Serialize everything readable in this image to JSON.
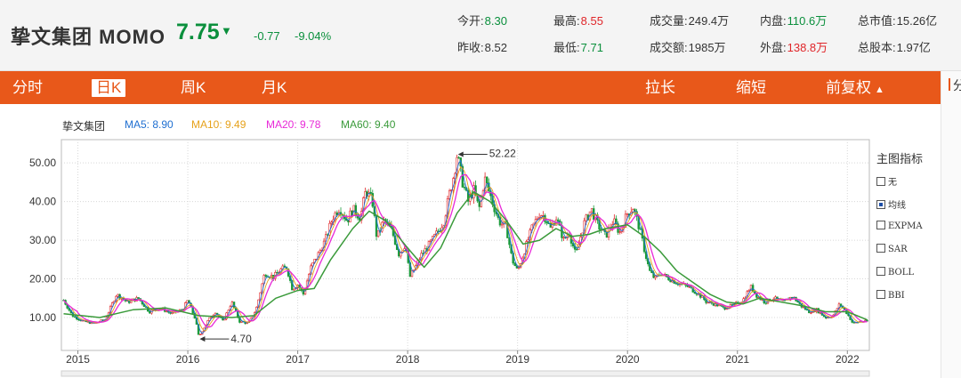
{
  "stock": {
    "name": "挚文集团",
    "ticker": "MOMO",
    "price": "7.75",
    "arrow": "▼",
    "change": "-0.77",
    "change_pct": "-9.04%"
  },
  "quote_stats": {
    "open": {
      "label": "今开:",
      "value": "8.30"
    },
    "prev_close": {
      "label": "昨收:",
      "value": "8.52"
    },
    "high": {
      "label": "最高:",
      "value": "8.55"
    },
    "low": {
      "label": "最低:",
      "value": "7.71"
    },
    "volume": {
      "label": "成交量:",
      "value": "249.4万"
    },
    "turnover": {
      "label": "成交额:",
      "value": "1985万"
    },
    "inner_vol": {
      "label": "内盘:",
      "value": "110.6万"
    },
    "outer_vol": {
      "label": "外盘:",
      "value": "138.8万"
    },
    "market_cap": {
      "label": "总市值:",
      "value": "15.26亿"
    },
    "total_shares": {
      "label": "总股本:",
      "value": "1.97亿"
    }
  },
  "toolbar": {
    "tabs": [
      "分时",
      "日K",
      "周K",
      "月K"
    ],
    "active_tab": "日K",
    "zoom_in": "拉长",
    "zoom_out": "缩短",
    "adjust": "前复权",
    "adjust_caret": "▲",
    "accent_color": "#e8581a"
  },
  "right_panel": {
    "label": "分"
  },
  "ma_legend": {
    "stock": "挚文集团",
    "ma5": "MA5: 8.90",
    "ma10": "MA10: 9.49",
    "ma20": "MA20: 9.78",
    "ma60": "MA60: 9.40",
    "colors": {
      "ma5": "#1f6fd1",
      "ma10": "#e6a11a",
      "ma20": "#e829d8",
      "ma60": "#3a9a3a"
    }
  },
  "indicator_panel": {
    "title": "主图指标",
    "options": [
      {
        "label": "无",
        "checked": false
      },
      {
        "label": "均线",
        "checked": true
      },
      {
        "label": "EXPMA",
        "checked": false
      },
      {
        "label": "SAR",
        "checked": false
      },
      {
        "label": "BOLL",
        "checked": false
      },
      {
        "label": "BBI",
        "checked": false
      }
    ]
  },
  "chart_data": {
    "type": "candlestick",
    "x_tick_labels": [
      "2015",
      "2016",
      "2017",
      "2018",
      "2019",
      "2020",
      "2021",
      "2022"
    ],
    "y_tick_labels": [
      "10.00",
      "20.00",
      "30.00",
      "40.00",
      "50.00"
    ],
    "ylim": [
      1.5,
      56
    ],
    "xlim": [
      2014.85,
      2022.2
    ],
    "grid": true,
    "annotations": [
      {
        "label": "52.22",
        "x": 2018.45,
        "y": 52.22
      },
      {
        "label": "4.70",
        "x": 2016.1,
        "y": 4.7
      }
    ],
    "price_path": [
      [
        2014.87,
        14.5
      ],
      [
        2014.95,
        10.5
      ],
      [
        2015.05,
        9.0
      ],
      [
        2015.15,
        8.5
      ],
      [
        2015.25,
        9.5
      ],
      [
        2015.35,
        16.0
      ],
      [
        2015.45,
        14.0
      ],
      [
        2015.55,
        15.0
      ],
      [
        2015.65,
        11.5
      ],
      [
        2015.75,
        12.5
      ],
      [
        2015.85,
        11.0
      ],
      [
        2015.95,
        12.0
      ],
      [
        2016.0,
        14.5
      ],
      [
        2016.07,
        9.5
      ],
      [
        2016.1,
        5.0
      ],
      [
        2016.18,
        9.0
      ],
      [
        2016.25,
        11.5
      ],
      [
        2016.32,
        9.0
      ],
      [
        2016.4,
        14.0
      ],
      [
        2016.47,
        9.0
      ],
      [
        2016.55,
        8.5
      ],
      [
        2016.62,
        12.0
      ],
      [
        2016.7,
        21.5
      ],
      [
        2016.78,
        20.5
      ],
      [
        2016.85,
        22.5
      ],
      [
        2016.9,
        23.0
      ],
      [
        2016.95,
        17.5
      ],
      [
        2017.0,
        18.5
      ],
      [
        2017.05,
        16.0
      ],
      [
        2017.12,
        23.0
      ],
      [
        2017.18,
        26.0
      ],
      [
        2017.25,
        30.0
      ],
      [
        2017.32,
        36.0
      ],
      [
        2017.38,
        38.5
      ],
      [
        2017.45,
        35.0
      ],
      [
        2017.5,
        38.0
      ],
      [
        2017.57,
        36.0
      ],
      [
        2017.62,
        43.0
      ],
      [
        2017.68,
        40.0
      ],
      [
        2017.72,
        30.5
      ],
      [
        2017.78,
        35.0
      ],
      [
        2017.85,
        33.0
      ],
      [
        2017.92,
        26.5
      ],
      [
        2017.98,
        29.0
      ],
      [
        2018.02,
        20.5
      ],
      [
        2018.07,
        23.0
      ],
      [
        2018.12,
        26.0
      ],
      [
        2018.2,
        29.0
      ],
      [
        2018.27,
        32.0
      ],
      [
        2018.33,
        35.0
      ],
      [
        2018.38,
        42.0
      ],
      [
        2018.42,
        47.0
      ],
      [
        2018.45,
        52.2
      ],
      [
        2018.5,
        45.0
      ],
      [
        2018.55,
        40.0
      ],
      [
        2018.6,
        43.0
      ],
      [
        2018.65,
        38.0
      ],
      [
        2018.7,
        46.0
      ],
      [
        2018.77,
        40.0
      ],
      [
        2018.83,
        35.0
      ],
      [
        2018.9,
        33.0
      ],
      [
        2018.95,
        25.0
      ],
      [
        2019.0,
        22.0
      ],
      [
        2019.07,
        28.0
      ],
      [
        2019.13,
        33.0
      ],
      [
        2019.2,
        37.0
      ],
      [
        2019.25,
        36.0
      ],
      [
        2019.3,
        33.0
      ],
      [
        2019.35,
        36.0
      ],
      [
        2019.42,
        30.0
      ],
      [
        2019.47,
        32.0
      ],
      [
        2019.53,
        26.0
      ],
      [
        2019.6,
        34.0
      ],
      [
        2019.67,
        38.0
      ],
      [
        2019.73,
        34.0
      ],
      [
        2019.8,
        31.0
      ],
      [
        2019.87,
        35.0
      ],
      [
        2019.93,
        32.0
      ],
      [
        2020.0,
        37.0
      ],
      [
        2020.05,
        38.5
      ],
      [
        2020.1,
        34.0
      ],
      [
        2020.15,
        28.0
      ],
      [
        2020.2,
        22.0
      ],
      [
        2020.25,
        20.0
      ],
      [
        2020.3,
        21.5
      ],
      [
        2020.35,
        20.5
      ],
      [
        2020.45,
        19.0
      ],
      [
        2020.55,
        18.0
      ],
      [
        2020.65,
        16.0
      ],
      [
        2020.72,
        14.0
      ],
      [
        2020.8,
        13.5
      ],
      [
        2020.87,
        12.5
      ],
      [
        2020.95,
        13.0
      ],
      [
        2021.05,
        14.5
      ],
      [
        2021.12,
        18.0
      ],
      [
        2021.18,
        15.5
      ],
      [
        2021.25,
        14.0
      ],
      [
        2021.33,
        15.0
      ],
      [
        2021.42,
        14.0
      ],
      [
        2021.5,
        15.5
      ],
      [
        2021.58,
        13.0
      ],
      [
        2021.65,
        11.5
      ],
      [
        2021.72,
        12.0
      ],
      [
        2021.8,
        10.0
      ],
      [
        2021.87,
        10.5
      ],
      [
        2021.93,
        13.5
      ],
      [
        2022.0,
        11.0
      ],
      [
        2022.05,
        8.5
      ],
      [
        2022.12,
        9.0
      ],
      [
        2022.18,
        9.0
      ]
    ],
    "ma60_path": [
      [
        2014.87,
        11.0
      ],
      [
        2015.2,
        10.0
      ],
      [
        2015.5,
        12.0
      ],
      [
        2015.8,
        12.5
      ],
      [
        2016.1,
        10.5
      ],
      [
        2016.4,
        10.0
      ],
      [
        2016.6,
        10.5
      ],
      [
        2016.8,
        15.0
      ],
      [
        2017.0,
        17.0
      ],
      [
        2017.15,
        17.5
      ],
      [
        2017.3,
        25.0
      ],
      [
        2017.5,
        33.0
      ],
      [
        2017.65,
        37.5
      ],
      [
        2017.8,
        35.0
      ],
      [
        2018.0,
        28.0
      ],
      [
        2018.15,
        23.0
      ],
      [
        2018.3,
        28.0
      ],
      [
        2018.45,
        37.0
      ],
      [
        2018.6,
        42.5
      ],
      [
        2018.75,
        40.0
      ],
      [
        2018.9,
        35.0
      ],
      [
        2019.05,
        29.0
      ],
      [
        2019.2,
        30.0
      ],
      [
        2019.35,
        33.0
      ],
      [
        2019.5,
        31.0
      ],
      [
        2019.65,
        31.5
      ],
      [
        2019.8,
        33.0
      ],
      [
        2020.0,
        34.0
      ],
      [
        2020.15,
        31.0
      ],
      [
        2020.3,
        27.0
      ],
      [
        2020.45,
        22.0
      ],
      [
        2020.6,
        19.0
      ],
      [
        2020.75,
        16.0
      ],
      [
        2020.9,
        14.0
      ],
      [
        2021.05,
        13.5
      ],
      [
        2021.2,
        15.0
      ],
      [
        2021.4,
        14.0
      ],
      [
        2021.6,
        13.0
      ],
      [
        2021.8,
        11.5
      ],
      [
        2022.0,
        11.5
      ],
      [
        2022.18,
        9.4
      ]
    ]
  }
}
